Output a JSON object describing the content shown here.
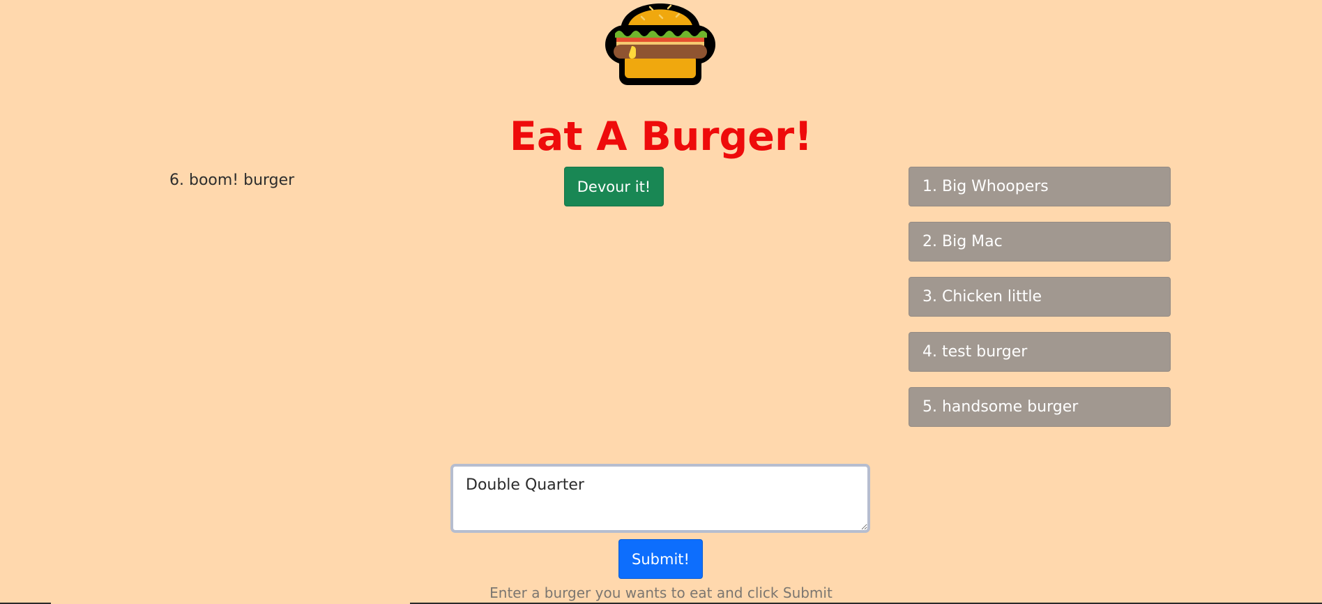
{
  "header": {
    "logo_icon": "hamburger-icon",
    "title": "Eat A Burger!"
  },
  "devoured": {
    "items": [
      "6. boom! burger"
    ]
  },
  "actions": {
    "devour_label": "Devour it!",
    "submit_label": "Submit!"
  },
  "menu": {
    "items": [
      "1. Big Whoopers",
      "2. Big Mac",
      "3. Chicken little",
      "4. test burger",
      "5. handsome burger"
    ]
  },
  "form": {
    "input_value": "Double Quarter",
    "help_text": "Enter a burger you wants to eat and click Submit"
  },
  "colors": {
    "background": "#ffd8ad",
    "title": "#ee0b0b",
    "devour_button": "#198754",
    "submit_button": "#0d6efd",
    "menu_item": "#a19890"
  }
}
